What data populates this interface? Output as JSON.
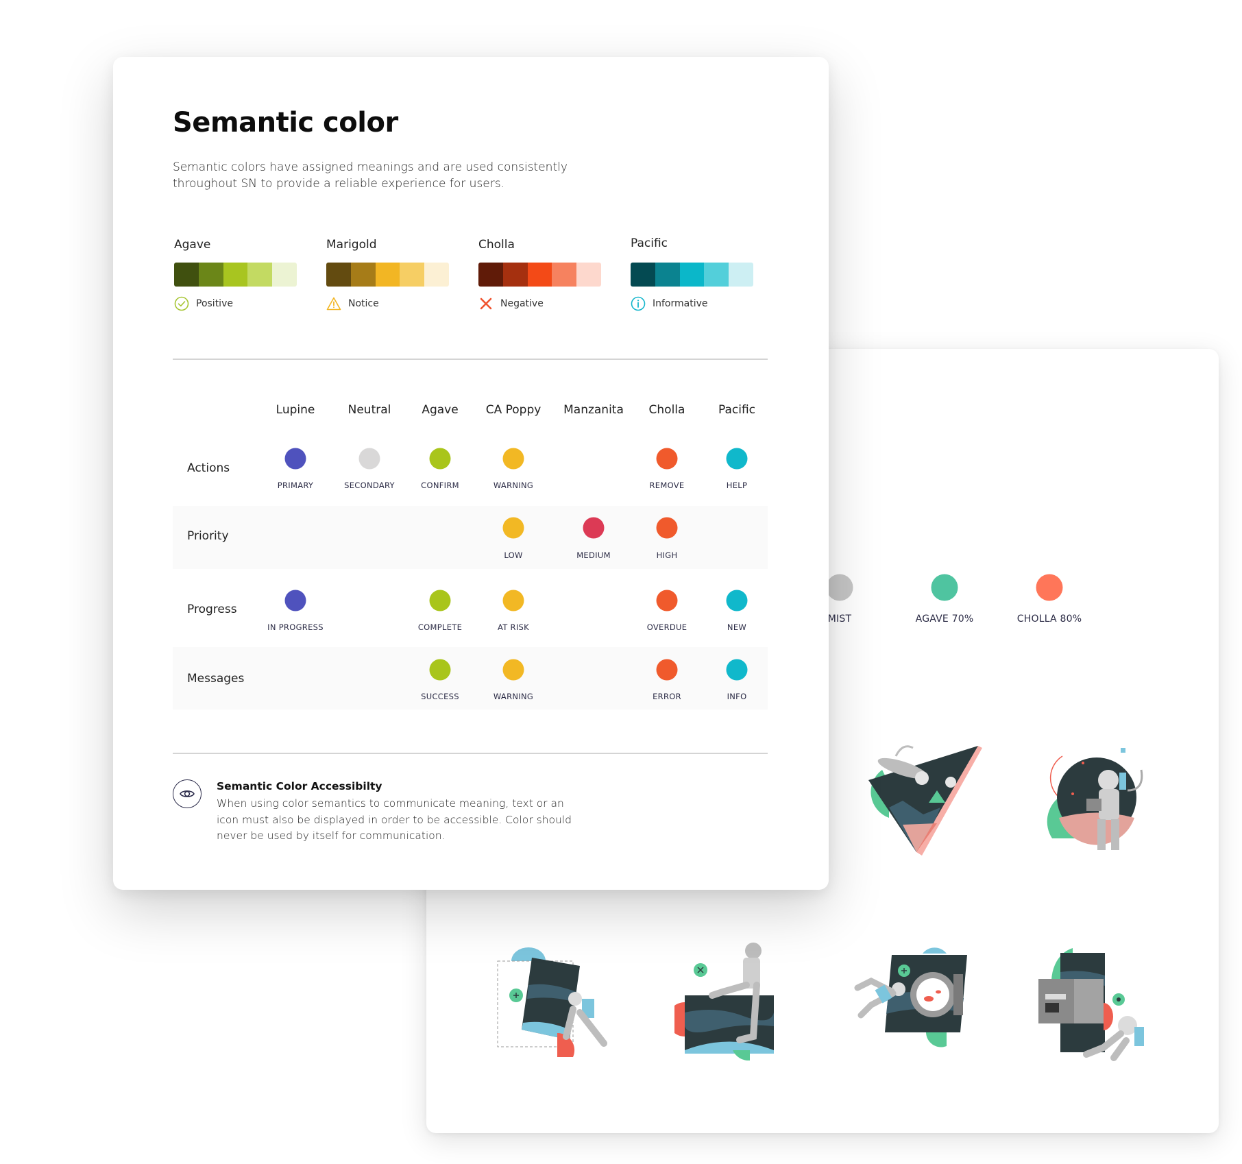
{
  "header": {
    "title": "Semantic color",
    "description": "Semantic colors have assigned meanings and are used consistently throughout SN to provide a reliable experience for users."
  },
  "palettes": [
    {
      "name": "Agave",
      "status": "Positive",
      "status_icon": "check-circle-icon",
      "icon_color": "#a6c532",
      "swatches": [
        "#40500f",
        "#6b8618",
        "#a8c520",
        "#c3da62",
        "#ecf3d3"
      ]
    },
    {
      "name": "Marigold",
      "status": "Notice",
      "status_icon": "warning-triangle-icon",
      "icon_color": "#f2b624",
      "swatches": [
        "#634b10",
        "#a67c18",
        "#f2b624",
        "#f6ce64",
        "#fcf0d4"
      ]
    },
    {
      "name": "Cholla",
      "status": "Negative",
      "status_icon": "x-icon",
      "icon_color": "#f0532f",
      "swatches": [
        "#601b08",
        "#a5300f",
        "#f34a17",
        "#f6825f",
        "#fdd8cd"
      ]
    },
    {
      "name": "Pacific",
      "status": "Informative",
      "status_icon": "info-circle-icon",
      "icon_color": "#14b6cc",
      "swatches": [
        "#044a52",
        "#0b8390",
        "#0bb7c9",
        "#53cfda",
        "#cdeff3"
      ]
    }
  ],
  "matrix": {
    "columns": [
      "Lupine",
      "Neutral",
      "Agave",
      "CA Poppy",
      "Manzanita",
      "Cholla",
      "Pacific"
    ],
    "column_colors": [
      "#4f52bd",
      "#d9d8d8",
      "#a9c51b",
      "#f2b824",
      "#dc3a55",
      "#f05a2c",
      "#10b8cb"
    ],
    "rows": [
      {
        "label": "Actions",
        "cells": [
          "PRIMARY",
          "SECONDARY",
          "CONFIRM",
          "WARNING",
          null,
          "REMOVE",
          "HELP"
        ]
      },
      {
        "label": "Priority",
        "cells": [
          null,
          null,
          null,
          "LOW",
          "MEDIUM",
          "HIGH",
          null
        ]
      },
      {
        "label": "Progress",
        "cells": [
          "IN PROGRESS",
          null,
          "COMPLETE",
          "AT RISK",
          null,
          "OVERDUE",
          "NEW"
        ]
      },
      {
        "label": "Messages",
        "cells": [
          null,
          null,
          "SUCCESS",
          "WARNING",
          null,
          "ERROR",
          "INFO"
        ]
      }
    ]
  },
  "accessibility": {
    "icon": "eye-icon",
    "title": "Semantic Color Accessibilty",
    "body": "When using color semantics to communicate meaning, text or an icon must also be displayed in order to be accessible. Color should never be used by itself for communication."
  },
  "back_card": {
    "chips": [
      {
        "label": "MIST",
        "color": "#c6c6c6"
      },
      {
        "label": "AGAVE 70%",
        "color": "#4fc4a0"
      },
      {
        "label": "CHOLLA 80%",
        "color": "#ff7659"
      }
    ],
    "illustrations": [
      "astronaut-triangle-illustration",
      "astronaut-planet-illustration",
      "astronaut-pushing-panel-illustration",
      "astronaut-sitting-panel-illustration",
      "astronaut-porthole-fish-illustration",
      "astronaut-server-illustration"
    ]
  }
}
